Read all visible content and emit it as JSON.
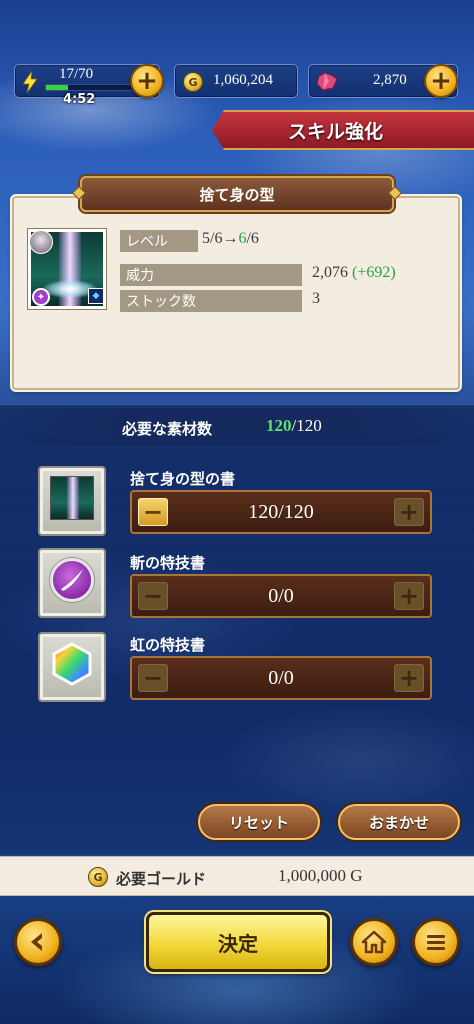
{
  "header": {
    "stamina": {
      "current_max": "17/70",
      "timer": "4:52",
      "fill_fraction": 0.24
    },
    "gold": {
      "value": "1,060,204",
      "icon_letter": "G"
    },
    "gems": {
      "value": "2,870"
    },
    "plus_label": "+"
  },
  "screen_title": "スキル強化",
  "skill": {
    "name": "捨て身の型",
    "level_label": "レベル",
    "level_from": "5/6→",
    "level_to": "6",
    "level_max": "/6",
    "power_label": "威力",
    "power_value": "2,076",
    "power_bonus": "(+692)",
    "stock_label": "ストック数",
    "stock_value": "3"
  },
  "materials": {
    "required_label": "必要な素材数",
    "required_current": "120",
    "required_total": "/120",
    "items": [
      {
        "name": "捨て身の型の書",
        "count": "120/120"
      },
      {
        "name": "斬の特技書",
        "count": "0/0"
      },
      {
        "name": "虹の特技書",
        "count": "0/0"
      }
    ],
    "minus_label": "−",
    "plus_label": "+"
  },
  "actions": {
    "reset_label": "リセット",
    "auto_label": "おまかせ"
  },
  "gold_requirement": {
    "coin_letter": "G",
    "label": "必要ゴールド",
    "value": "1,000,000 G"
  },
  "footer": {
    "confirm_label": "決定"
  },
  "colors": {
    "accent_green": "#2aa04a",
    "ribbon_red": "#c5343f",
    "button_gold": "#f0b21e"
  }
}
